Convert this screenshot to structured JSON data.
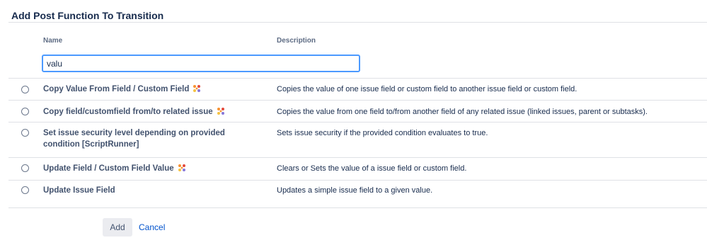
{
  "dialog": {
    "title": "Add Post Function To Transition"
  },
  "table": {
    "columns": {
      "name": "Name",
      "description": "Description"
    },
    "search": {
      "value": "valu"
    },
    "rows": [
      {
        "name": "Copy Value From Field / Custom Field",
        "description": "Copies the value of one issue field or custom field to another issue field or custom field.",
        "icon": "scriptrunner-icon"
      },
      {
        "name": "Copy field/customfield from/to related issue",
        "description": "Copies the value from one field to/from another field of any related issue (linked issues, parent or subtasks).",
        "icon": "scriptrunner-icon"
      },
      {
        "name": "Set issue security level depending on provided condition [ScriptRunner]",
        "description": "Sets issue security if the provided condition evaluates to true.",
        "icon": ""
      },
      {
        "name": "Update Field / Custom Field Value",
        "description": "Clears or Sets the value of a issue field or custom field.",
        "icon": "scriptrunner-icon"
      },
      {
        "name": "Update Issue Field",
        "description": "Updates a simple issue field to a given value.",
        "icon": ""
      }
    ]
  },
  "actions": {
    "add_label": "Add",
    "cancel_label": "Cancel"
  }
}
